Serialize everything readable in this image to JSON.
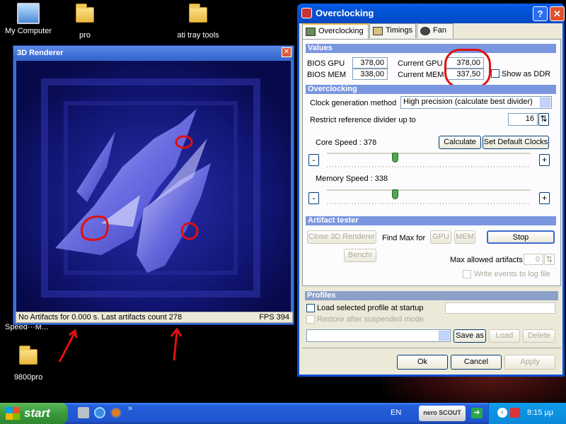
{
  "desktop": {
    "icons": [
      {
        "label": "My Computer",
        "icon": "computer-icon"
      },
      {
        "label": "pro",
        "icon": "folder-icon"
      },
      {
        "label": "ati tray tools",
        "icon": "folder-icon"
      },
      {
        "label": "9800pro",
        "icon": "folder-icon"
      }
    ],
    "partial_label": "Speed···M..."
  },
  "renderer": {
    "title": "3D Renderer",
    "status": "No Artifacts for 0.000 s. Last artifacts count 278",
    "fps": "FPS 394"
  },
  "oc": {
    "title": "Overclocking",
    "tabs": [
      "Overclocking",
      "Timings",
      "Fan"
    ],
    "values": {
      "header": "Values",
      "bios_gpu_label": "BIOS GPU",
      "bios_gpu": "378,00",
      "bios_mem_label": "BIOS MEM",
      "bios_mem": "338,00",
      "cur_gpu_label": "Current GPU",
      "cur_gpu": "378,00",
      "cur_mem_label": "Current MEM",
      "cur_mem": "337,50",
      "ddr_label": "Show as DDR"
    },
    "overclocking": {
      "header": "Overclocking",
      "method_label": "Clock generation method",
      "method_value": "High precision (calculate best divider)",
      "restrict_label": "Restrict reference divider up to",
      "restrict_value": "16",
      "core_label": "Core Speed : 378",
      "calculate": "Calculate",
      "default_clocks": "Set Default Clocks",
      "mem_label": "Memory Speed : 338",
      "minus": "-",
      "plus": "+",
      "core_level": 0.33,
      "mem_level": 0.33
    },
    "artifact": {
      "header": "Artifact tester",
      "close_renderer": "Close 3D Renderer",
      "find_max": "Find Max for",
      "gpu": "GPU",
      "mem": "MEM",
      "stop": "Stop",
      "bench": "Bench!",
      "max_allowed_label": "Max allowed artifacts",
      "max_allowed_value": "0",
      "write_events": "Write events to log file"
    },
    "profiles": {
      "header": "Profiles",
      "load_startup": "Load selected profile at startup",
      "restore": "Restore after suspended mode",
      "save_as": "Save as",
      "load": "Load",
      "delete": "Delete"
    },
    "buttons": {
      "ok": "Ok",
      "cancel": "Cancel",
      "apply": "Apply"
    }
  },
  "taskbar": {
    "start": "start",
    "lang": "EN",
    "nero": "nero SCOUT",
    "clock": "8:15 μμ"
  },
  "colors": {
    "annotation": "#e01010",
    "selection_blue": "#0a4fd6"
  }
}
